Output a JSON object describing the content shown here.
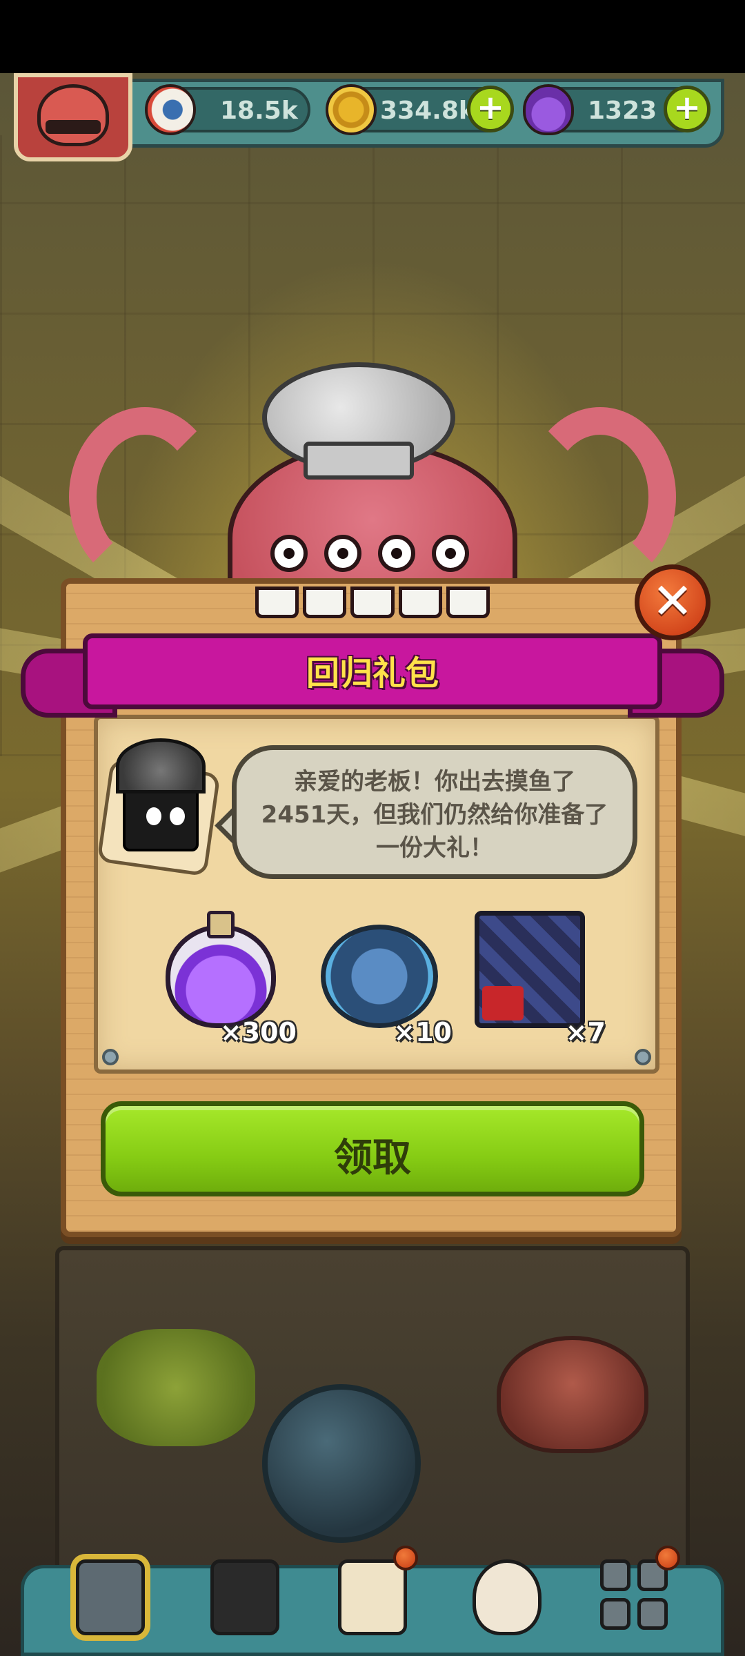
{
  "hud": {
    "eyes": {
      "icon": "eyeball-icon",
      "value": "18.5k"
    },
    "coins": {
      "icon": "coin-icon",
      "value": "334.8k"
    },
    "potions": {
      "icon": "potion-icon",
      "value": "1323"
    },
    "plus_symbol": "+"
  },
  "dialog": {
    "title": "回归礼包",
    "close_symbol": "✕",
    "message_lines": [
      "亲爱的老板！你出去摸鱼了",
      "2451天，但我们仍然给你准备了",
      "一份大礼！"
    ],
    "rewards": [
      {
        "icon": "purple-potion-icon",
        "qty": "×300"
      },
      {
        "icon": "gear-coin-icon",
        "qty": "×10"
      },
      {
        "icon": "ticket-pack-icon",
        "qty": "×7"
      }
    ],
    "claim_label": "领取"
  },
  "bottom_nav": [
    {
      "icon": "building-icon",
      "active": true
    },
    {
      "icon": "monster-icon",
      "active": false
    },
    {
      "icon": "book-icon",
      "active": false,
      "badge": true
    },
    {
      "icon": "money-bag-icon",
      "active": false
    },
    {
      "icon": "grid-menu-icon",
      "active": false,
      "badge": true
    }
  ],
  "colors": {
    "ribbon": "#c8179e",
    "title_text": "#ffe24a",
    "claim_button": "#86cc14",
    "close_button": "#d2451b",
    "hud_bar": "#4e8f8c"
  }
}
